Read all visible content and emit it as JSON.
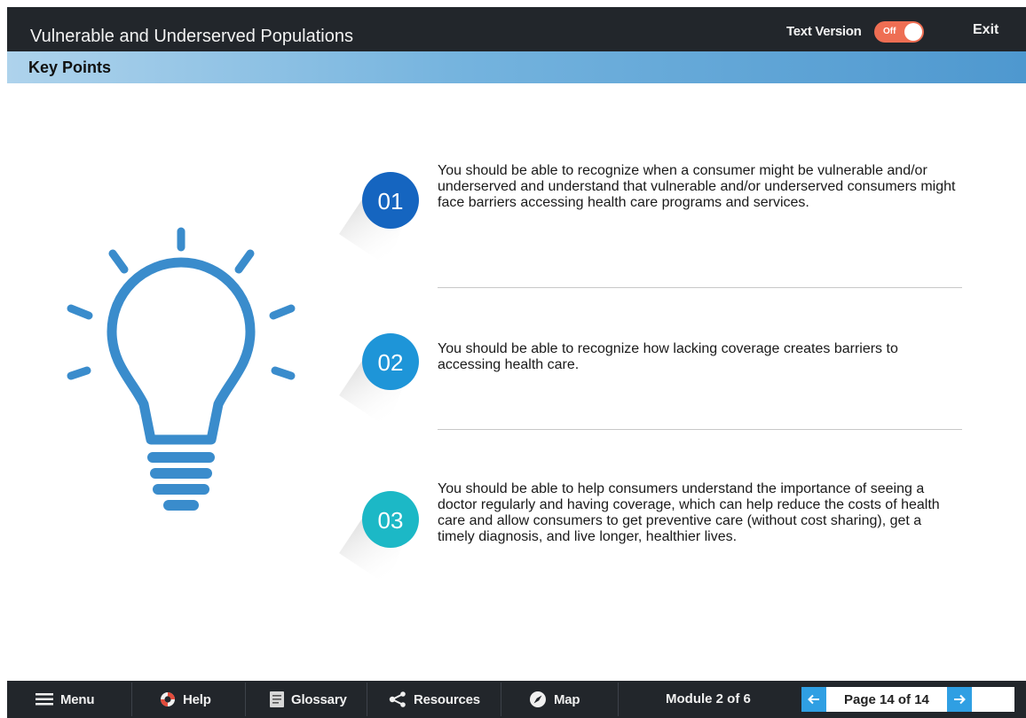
{
  "header": {
    "title": "Vulnerable and Underserved Populations",
    "text_version_label": "Text Version",
    "toggle_state": "Off",
    "exit_label": "Exit"
  },
  "section": {
    "title": "Key Points"
  },
  "key_points": [
    {
      "number": "01",
      "text": "You should be able to recognize when a consumer might be vulnerable and/or underserved and understand that vulnerable and/or underserved consumers might face barriers accessing health care programs and services.",
      "color": "#1565c0"
    },
    {
      "number": "02",
      "text": "You should be able to recognize how lacking coverage creates barriers to accessing health care.",
      "color": "#1e95d8"
    },
    {
      "number": "03",
      "text": "You should be able to help consumers understand the importance of seeing a doctor regularly and having coverage, which can help reduce the costs of health care and allow consumers to get preventive care (without cost sharing), get a timely diagnosis, and live longer, healthier lives.",
      "color": "#1cb8c6"
    }
  ],
  "illustration": {
    "icon": "lightbulb-icon",
    "color": "#3a8ccc"
  },
  "footer": {
    "menu_label": "Menu",
    "help_label": "Help",
    "glossary_label": "Glossary",
    "resources_label": "Resources",
    "map_label": "Map",
    "module_text": "Module 2 of 6",
    "page_text": "Page 14 of 14"
  },
  "colors": {
    "topbar": "#22262b",
    "toggle_off": "#ee6e53",
    "accent_blue": "#2f9fe3"
  }
}
